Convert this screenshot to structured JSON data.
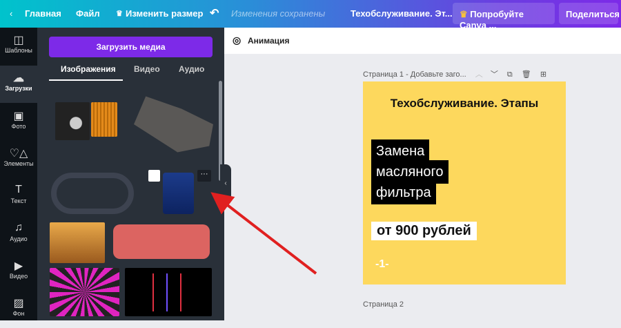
{
  "topbar": {
    "home": "Главная",
    "file": "Файл",
    "resize": "Изменить размер",
    "saved": "Изменения сохранены",
    "doc_title": "Техобслуживание. Эт...",
    "try_canva": "Попробуйте Canva ...",
    "share": "Поделиться"
  },
  "rail": [
    {
      "label": "Шаблоны",
      "icon": "templates-icon"
    },
    {
      "label": "Загрузки",
      "icon": "upload-cloud-icon"
    },
    {
      "label": "Фото",
      "icon": "photo-icon"
    },
    {
      "label": "Элементы",
      "icon": "elements-icon"
    },
    {
      "label": "Текст",
      "icon": "text-icon"
    },
    {
      "label": "Аудио",
      "icon": "audio-icon"
    },
    {
      "label": "Видео",
      "icon": "video-icon"
    },
    {
      "label": "Фон",
      "icon": "background-icon"
    }
  ],
  "panel": {
    "upload_button": "Загрузить медиа",
    "tabs": [
      "Изображения",
      "Видео",
      "Аудио"
    ]
  },
  "toolbar": {
    "animation": "Анимация"
  },
  "page1": {
    "header": "Страница 1 - Добавьте заго...",
    "title": "Техобслуживание. Этапы",
    "lines": [
      "Замена",
      "масляного",
      "фильтра"
    ],
    "price": "от 900 рублей",
    "number": "-1-"
  },
  "page2": {
    "header": "Страница 2"
  },
  "colors": {
    "accent": "#7d2ae8",
    "page_bg": "#fdd85d",
    "arrow": "#e02020"
  }
}
